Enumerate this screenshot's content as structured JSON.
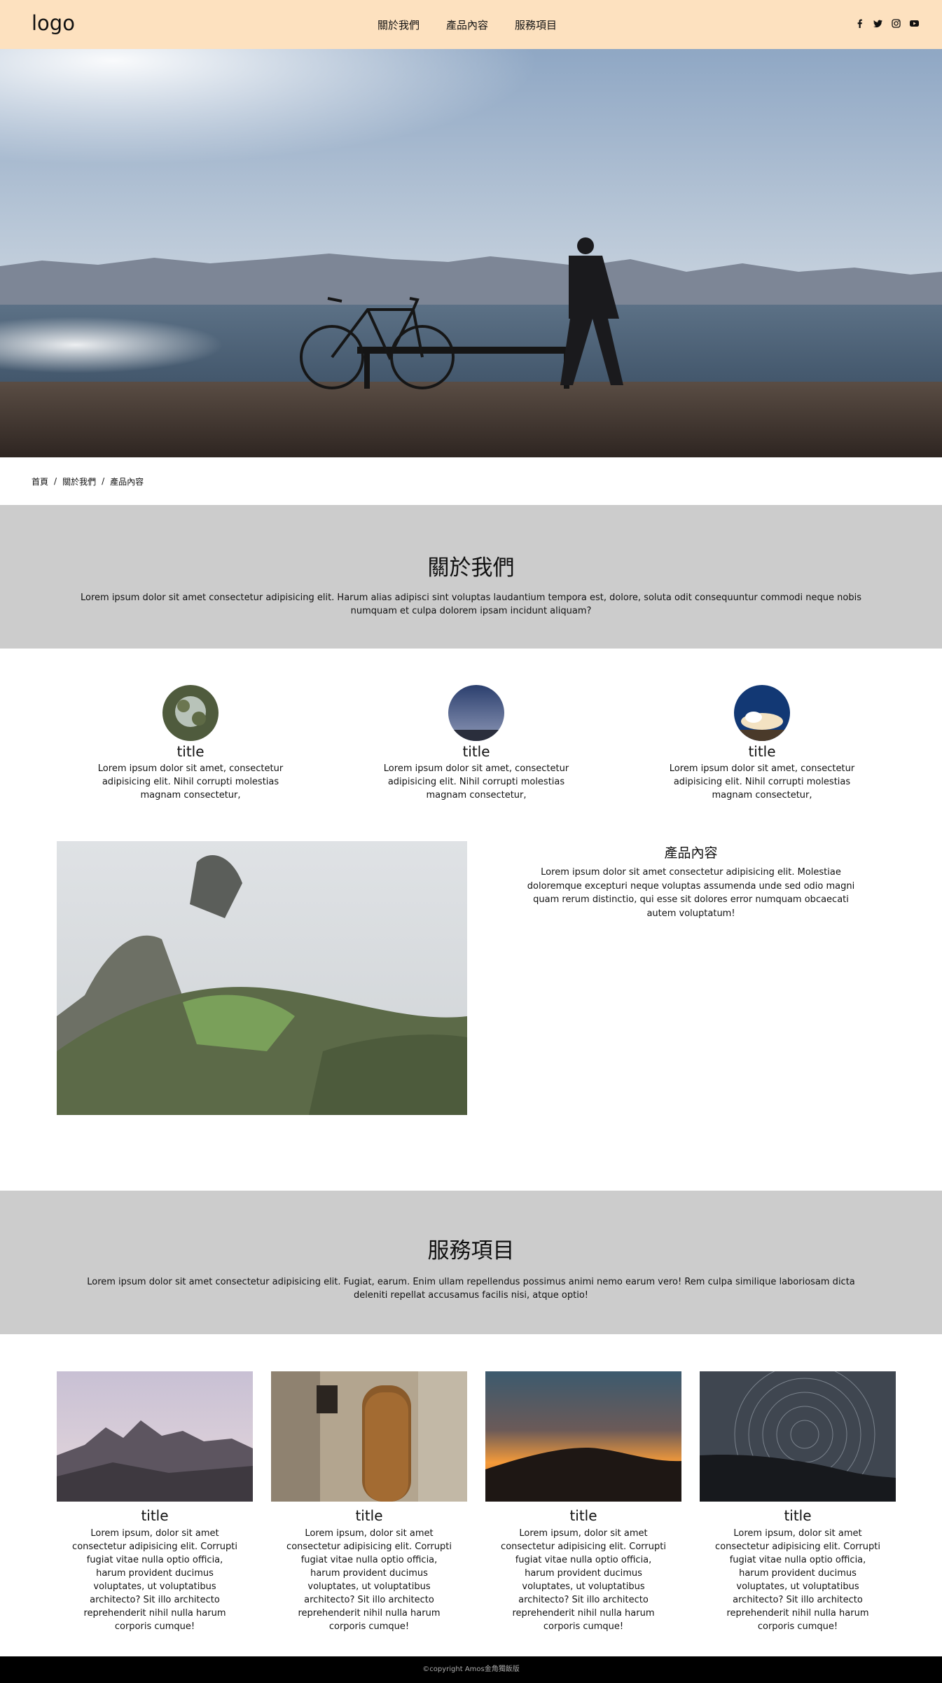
{
  "header": {
    "logo": "logo",
    "nav": [
      "關於我們",
      "產品內容",
      "服務項目"
    ],
    "social_icons": [
      "facebook-icon",
      "twitter-icon",
      "instagram-icon",
      "youtube-icon"
    ]
  },
  "breadcrumb": [
    "首頁",
    "關於我們",
    "產品內容"
  ],
  "about": {
    "title": "關於我們",
    "text": "Lorem ipsum dolor sit amet consectetur adipisicing elit. Harum alias adipisci sint voluptas laudantium tempora est, dolore, soluta odit consequuntur commodi neque nobis numquam et culpa dolorem ipsam incidunt aliquam?"
  },
  "features": [
    {
      "title": "title",
      "text": "Lorem ipsum dolor sit amet, consectetur adipisicing elit. Nihil corrupti molestias magnam consectetur,"
    },
    {
      "title": "title",
      "text": "Lorem ipsum dolor sit amet, consectetur adipisicing elit. Nihil corrupti molestias magnam consectetur,"
    },
    {
      "title": "title",
      "text": "Lorem ipsum dolor sit amet, consectetur adipisicing elit. Nihil corrupti molestias magnam consectetur,"
    }
  ],
  "product": {
    "title": "產品內容",
    "text": "Lorem ipsum dolor sit amet consectetur adipisicing elit. Molestiae doloremque excepturi neque voluptas assumenda unde sed odio magni quam rerum distinctio, qui esse sit dolores error numquam obcaecati autem voluptatum!"
  },
  "services": {
    "title": "服務項目",
    "text": "Lorem ipsum dolor sit amet consectetur adipisicing elit. Fugiat, earum. Enim ullam repellendus possimus animi nemo earum vero! Rem culpa similique laboriosam dicta deleniti repellat accusamus facilis nisi, atque optio!",
    "cards": [
      {
        "title": "title",
        "text": "Lorem ipsum, dolor sit amet consectetur adipisicing elit. Corrupti fugiat vitae nulla optio officia, harum provident ducimus voluptates, ut voluptatibus architecto? Sit illo architecto reprehenderit nihil nulla harum corporis cumque!"
      },
      {
        "title": "title",
        "text": "Lorem ipsum, dolor sit amet consectetur adipisicing elit. Corrupti fugiat vitae nulla optio officia, harum provident ducimus voluptates, ut voluptatibus architecto? Sit illo architecto reprehenderit nihil nulla harum corporis cumque!"
      },
      {
        "title": "title",
        "text": "Lorem ipsum, dolor sit amet consectetur adipisicing elit. Corrupti fugiat vitae nulla optio officia, harum provident ducimus voluptates, ut voluptatibus architecto? Sit illo architecto reprehenderit nihil nulla harum corporis cumque!"
      },
      {
        "title": "title",
        "text": "Lorem ipsum, dolor sit amet consectetur adipisicing elit. Corrupti fugiat vitae nulla optio officia, harum provident ducimus voluptates, ut voluptatibus architecto? Sit illo architecto reprehenderit nihil nulla harum corporis cumque!"
      }
    ]
  },
  "footer": {
    "copyright": "©copyright Amos金角獨飯版"
  },
  "colors": {
    "header_bg": "#fde1bf",
    "band_bg": "#cccccc",
    "footer_bg": "#000000"
  }
}
